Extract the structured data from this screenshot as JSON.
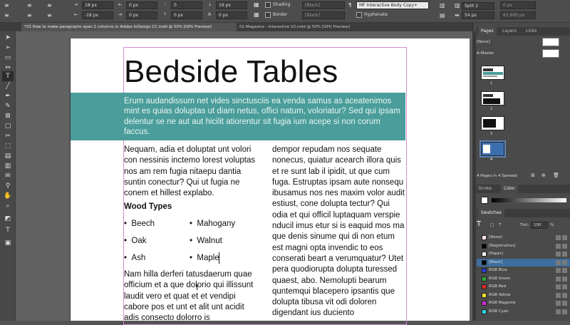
{
  "control_panel": {
    "left_values": [
      "18 px",
      "-18 px"
    ],
    "mid_values": [
      "0 px",
      "0 px"
    ],
    "right_values": [
      "0",
      "0 px"
    ],
    "right2_values": [
      "19 px",
      "0 px"
    ],
    "shading_label": "Shading",
    "border_label": "Border",
    "color_field": "[Black]",
    "color_field2": "[Black]",
    "paragraph_style": "MF Interactive Body Copy+",
    "hyphenate_label": "Hyphenate",
    "span_value": "Split 2",
    "gutter_value": "54 px",
    "inside_gutter_value": "0 px",
    "width_value": "62.600 px"
  },
  "tabs": [
    {
      "label": "*23 How to make paragraphs span 2 columns in Adobe InDesign CC.indd @ 50% [GPU Preview]",
      "active": true
    },
    {
      "label": "02 Magazine - Interactive V2.indd @ 50% [GPU Preview]",
      "active": false
    }
  ],
  "document": {
    "title": "Bedside Tables",
    "intro": "Erum audandissum net vides sinctusciis ea venda samus as aceatenimos mint es quias doluptas ut diam netus, offici natum, voloriatur? Sed qui ipsam delentur se ne aut aut hicilit atiorentur sit fugia ium acepe si non corum faccus.",
    "col1_para1": "Nequam, adia et doluptat unt volori con nessinis inctemo lorest voluptas nos am rem fugia nitaepu dantia suntin conectur? Qui ut fugia ne conem et hillest explabo.",
    "wood_heading": "Wood Types",
    "wood_col1": [
      "Beech",
      "Oak",
      "Ash"
    ],
    "wood_col2": [
      "Mahogany",
      "Walnut",
      "Maple"
    ],
    "bullet": "•",
    "col1_para2": "Nam hilla derferi tatusdaerum quae officium et a que dolorio qui illissunt laudit vero et quat et et vendipi cabore pos et unt et alit unt acidit adis consecto dolorro is",
    "col2_text": "dempor repudam nos sequate nonecus, quiatur acearch illora quis et re sunt lab il ipidit, ut que cum fuga. Estruptas ipsam aute nonsequ ibusamus nos nes maxim volor audit estiust, cone dolupta tectur? Qui odia et qui officil luptaquam verspie nducil imus etur si is eaquid mos ma que denis sinume qui di non etum est magni opta invendic to eos conserati beart a verumquatur? Utet pera quodiorupta dolupta turessed quaest, abo. Nemolupti bearum quntemqui blacepero ipsantis que dolupta tibusa vit odi doloren digendant ius duciento"
  },
  "pages_panel": {
    "tabs": [
      "Pages",
      "Layers",
      "Links"
    ],
    "none_label": "[None]",
    "master_label": "A-Master",
    "page_numbers": [
      "1",
      "2",
      "3",
      "4"
    ],
    "status": "4 Pages in 4 Spreads"
  },
  "stroke_color_panel": {
    "tabs": [
      "Stroke",
      "Color"
    ]
  },
  "swatches_panel": {
    "title": "Swatches",
    "tint_label": "Tint:",
    "tint_value": "100",
    "tint_unit": "%",
    "swatches": [
      {
        "name": "[None]",
        "color": "#ffffff"
      },
      {
        "name": "[Registration]",
        "color": "#000000"
      },
      {
        "name": "[Paper]",
        "color": "#ffffff"
      },
      {
        "name": "[Black]",
        "color": "#000000"
      },
      {
        "name": "RGB Blue",
        "color": "#2a3bd8"
      },
      {
        "name": "RGB Green",
        "color": "#2fae3a"
      },
      {
        "name": "RGB Red",
        "color": "#e02a2a"
      },
      {
        "name": "RGB Yellow",
        "color": "#f2e12a"
      },
      {
        "name": "RGB Magenta",
        "color": "#d12ad1"
      },
      {
        "name": "RGB Cyan",
        "color": "#2ad4e8"
      }
    ]
  },
  "colors": {
    "band": "#4a9d9a",
    "selection": "#3e6e9e"
  }
}
